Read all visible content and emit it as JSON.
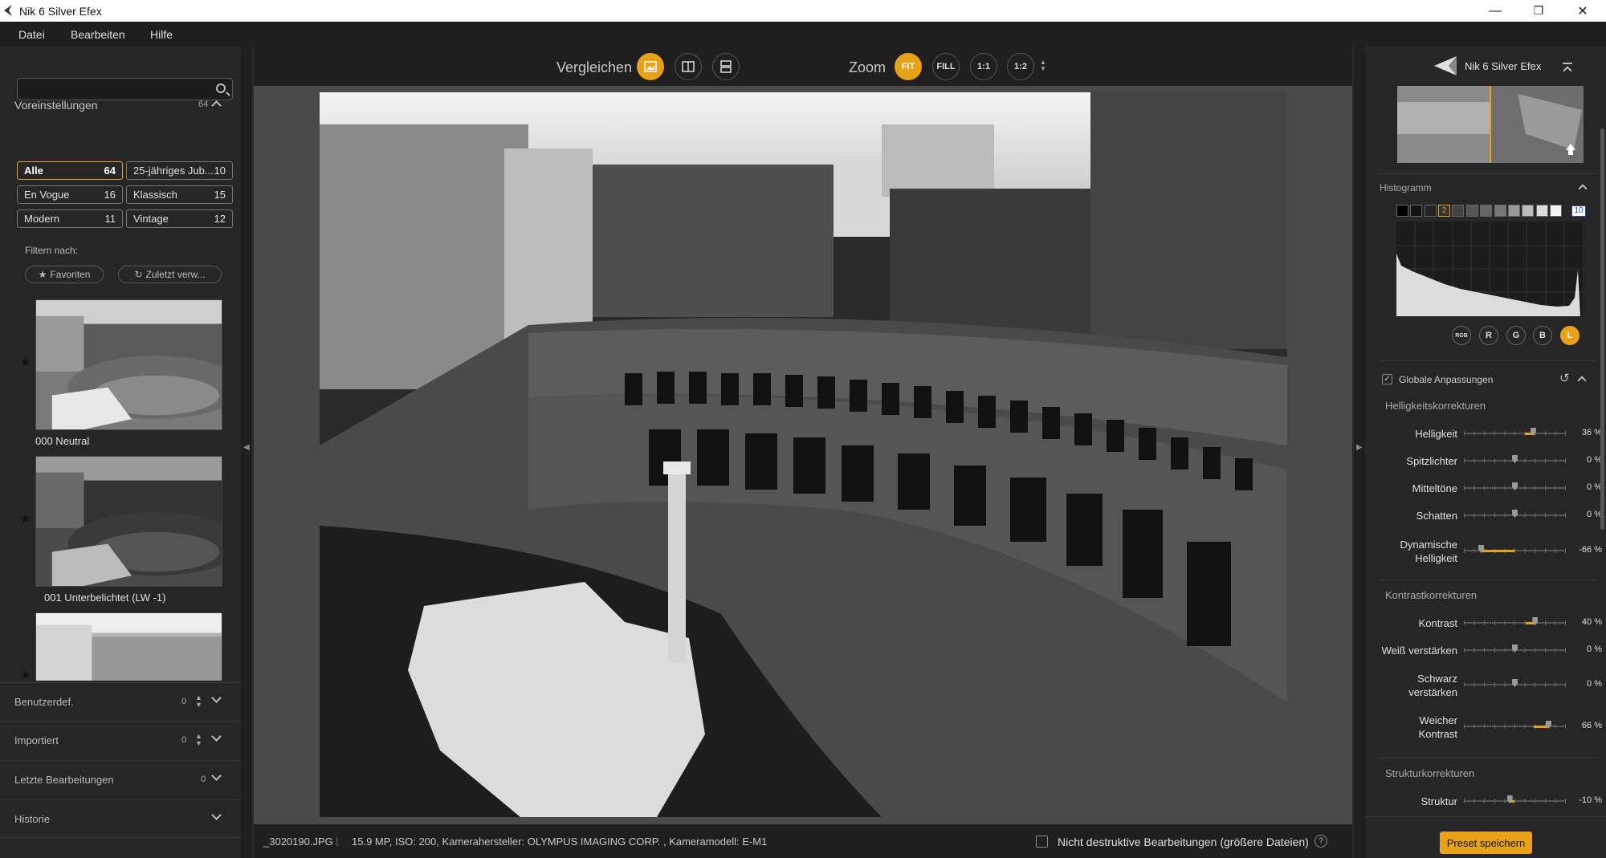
{
  "window": {
    "title": "Nik 6 Silver Efex",
    "minimize": "—",
    "maximize": "❐",
    "close": "✕"
  },
  "menu": [
    "Datei",
    "Bearbeiten",
    "Hilfe"
  ],
  "left": {
    "presets_title": "Voreinstellungen",
    "presets_count": "64",
    "search_placeholder": "",
    "categories": [
      {
        "label": "Alle",
        "count": "64"
      },
      {
        "label": "25-jähriges Jub...",
        "count": "10"
      },
      {
        "label": "En Vogue",
        "count": "16"
      },
      {
        "label": "Klassisch",
        "count": "15"
      },
      {
        "label": "Modern",
        "count": "11"
      },
      {
        "label": "Vintage",
        "count": "12"
      }
    ],
    "filter_label": "Filtern nach:",
    "favorites_label": "Favoriten",
    "recent_label": "Zuletzt verw...",
    "thumbnails": [
      "000 Neutral",
      "001 Unterbelichtet (LW -1)"
    ],
    "sections": [
      {
        "label": "Benutzerdef.",
        "count": "0"
      },
      {
        "label": "Importiert",
        "count": "0"
      },
      {
        "label": "Letzte Bearbeitungen",
        "count": "0"
      },
      {
        "label": "Historie",
        "count": ""
      }
    ]
  },
  "toolbar": {
    "compare_label": "Vergleichen",
    "zoom_label": "Zoom",
    "zoom_fit": "FIT",
    "zoom_fill": "FILL",
    "zoom_1_1": "1:1",
    "zoom_1_2": "1:2"
  },
  "infobar": {
    "filename": "_3020190.JPG",
    "details": "15.9 MP, ISO: 200, Kamerahersteller: OLYMPUS IMAGING CORP.  , Kameramodell: E-M1",
    "nondestructive_label": "Nicht destruktive Bearbeitungen (größere Dateien)",
    "help": "?"
  },
  "right": {
    "brand": "Nik 6 Silver Efex",
    "histogram_title": "Histogramm",
    "zone_active": "2",
    "zone_last": "10",
    "channels": [
      "RGB",
      "R",
      "G",
      "B",
      "L"
    ],
    "global_title": "Globale Anpassungen",
    "brightness_section": "Helligkeitskorrekturen",
    "contrast_section": "Kontrastkorrekturen",
    "structure_section": "Strukturkorrekturen",
    "adjustments": [
      {
        "label": "Helligkeit",
        "value": "36 %",
        "pct": 36
      },
      {
        "label": "Spitzlichter",
        "value": "0 %",
        "pct": 0
      },
      {
        "label": "Mitteltöne",
        "value": "0 %",
        "pct": 0
      },
      {
        "label": "Schatten",
        "value": "0 %",
        "pct": 0
      },
      {
        "label": "Dynamische\nHelligkeit",
        "value": "-66 %",
        "pct": -66
      },
      {
        "label": "Kontrast",
        "value": "40 %",
        "pct": 40
      },
      {
        "label": "Weiß verstärken",
        "value": "0 %",
        "pct": 0
      },
      {
        "label": "Schwarz\nverstärken",
        "value": "0 %",
        "pct": 0
      },
      {
        "label": "Weicher\nKontrast",
        "value": "66 %",
        "pct": 66
      },
      {
        "label": "Struktur",
        "value": "-10 %",
        "pct": -10
      }
    ],
    "save_button": "Preset speichern"
  }
}
